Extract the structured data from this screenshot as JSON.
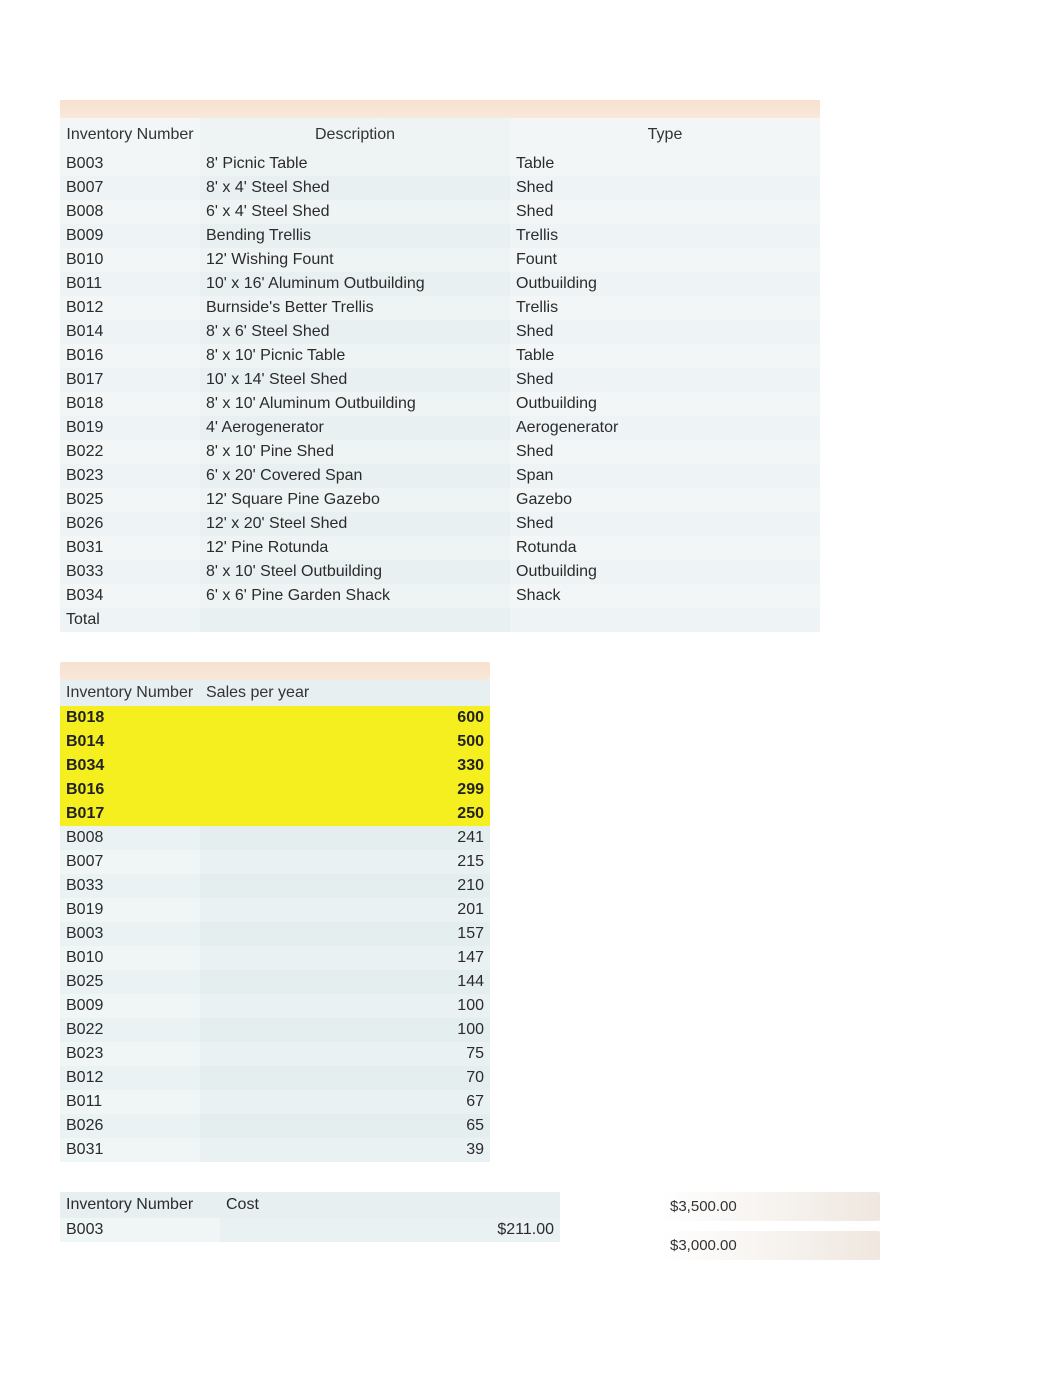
{
  "table1": {
    "headers": {
      "inv": "Inventory Number",
      "desc": "Description",
      "type": "Type"
    },
    "rows": [
      {
        "inv": "B003",
        "desc": "8'  Picnic Table",
        "type": "Table"
      },
      {
        "inv": "B007",
        "desc": "8' x 4' Steel Shed",
        "type": "Shed"
      },
      {
        "inv": "B008",
        "desc": "6' x 4' Steel Shed",
        "type": "Shed"
      },
      {
        "inv": "B009",
        "desc": "Bending Trellis",
        "type": "Trellis"
      },
      {
        "inv": "B010",
        "desc": "12' Wishing Fount",
        "type": "Fount"
      },
      {
        "inv": "B011",
        "desc": "10' x 16' Aluminum Outbuilding",
        "type": "Outbuilding"
      },
      {
        "inv": "B012",
        "desc": "Burnside's Better Trellis",
        "type": "Trellis"
      },
      {
        "inv": "B014",
        "desc": "8' x 6' Steel Shed",
        "type": "Shed"
      },
      {
        "inv": "B016",
        "desc": "8' x 10' Picnic Table",
        "type": "Table"
      },
      {
        "inv": "B017",
        "desc": "10' x 14' Steel Shed",
        "type": "Shed"
      },
      {
        "inv": "B018",
        "desc": "8' x 10' Aluminum Outbuilding",
        "type": "Outbuilding"
      },
      {
        "inv": "B019",
        "desc": "4' Aerogenerator",
        "type": "Aerogenerator"
      },
      {
        "inv": "B022",
        "desc": "8' x 10' Pine Shed",
        "type": "Shed"
      },
      {
        "inv": "B023",
        "desc": "6' x 20' Covered Span",
        "type": "Span"
      },
      {
        "inv": "B025",
        "desc": "12' Square Pine Gazebo",
        "type": "Gazebo"
      },
      {
        "inv": "B026",
        "desc": "12' x 20' Steel Shed",
        "type": "Shed"
      },
      {
        "inv": "B031",
        "desc": "12' Pine Rotunda",
        "type": "Rotunda"
      },
      {
        "inv": "B033",
        "desc": "8' x 10' Steel Outbuilding",
        "type": "Outbuilding"
      },
      {
        "inv": "B034",
        "desc": "6' x 6' Pine Garden Shack",
        "type": "Shack"
      }
    ],
    "total_label": "Total"
  },
  "table2": {
    "headers": {
      "inv": "Inventory Number",
      "val": "Sales per year"
    },
    "rows": [
      {
        "inv": "B018",
        "val": "600",
        "hl": true
      },
      {
        "inv": "B014",
        "val": "500",
        "hl": true
      },
      {
        "inv": "B034",
        "val": "330",
        "hl": true
      },
      {
        "inv": "B016",
        "val": "299",
        "hl": true
      },
      {
        "inv": "B017",
        "val": "250",
        "hl": true
      },
      {
        "inv": "B008",
        "val": "241",
        "hl": false
      },
      {
        "inv": "B007",
        "val": "215",
        "hl": false
      },
      {
        "inv": "B033",
        "val": "210",
        "hl": false
      },
      {
        "inv": "B019",
        "val": "201",
        "hl": false
      },
      {
        "inv": "B003",
        "val": "157",
        "hl": false
      },
      {
        "inv": "B010",
        "val": "147",
        "hl": false
      },
      {
        "inv": "B025",
        "val": "144",
        "hl": false
      },
      {
        "inv": "B009",
        "val": "100",
        "hl": false
      },
      {
        "inv": "B022",
        "val": "100",
        "hl": false
      },
      {
        "inv": "B023",
        "val": "75",
        "hl": false
      },
      {
        "inv": "B012",
        "val": "70",
        "hl": false
      },
      {
        "inv": "B011",
        "val": "67",
        "hl": false
      },
      {
        "inv": "B026",
        "val": "65",
        "hl": false
      },
      {
        "inv": "B031",
        "val": "39",
        "hl": false
      }
    ]
  },
  "table3": {
    "headers": {
      "inv": "Inventory Number",
      "val": "Cost"
    },
    "rows": [
      {
        "inv": "B003",
        "val": "$211.00"
      }
    ]
  },
  "side_amounts": [
    "$3,500.00",
    "$3,000.00"
  ]
}
